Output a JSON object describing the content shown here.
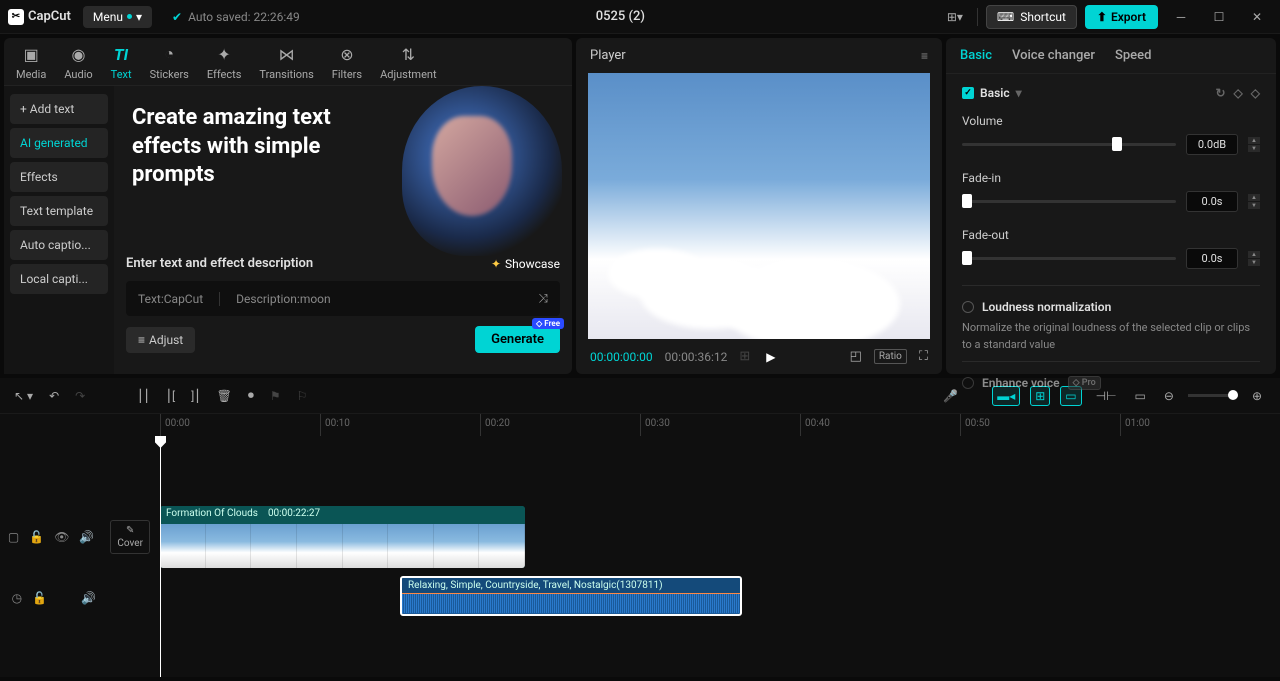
{
  "titlebar": {
    "app_name": "CapCut",
    "menu_label": "Menu",
    "autosave_text": "Auto saved: 22:26:49",
    "project_title": "0525 (2)",
    "shortcut_label": "Shortcut",
    "export_label": "Export"
  },
  "top_tabs": [
    {
      "label": "Media",
      "icon": "▶"
    },
    {
      "label": "Audio",
      "icon": "◉"
    },
    {
      "label": "Text",
      "icon": "TI",
      "active": true
    },
    {
      "label": "Stickers",
      "icon": "◔"
    },
    {
      "label": "Effects",
      "icon": "✦"
    },
    {
      "label": "Transitions",
      "icon": "⋈"
    },
    {
      "label": "Filters",
      "icon": "⊗"
    },
    {
      "label": "Adjustment",
      "icon": "⇄"
    }
  ],
  "sidebar": [
    {
      "label": "Add text",
      "add": true
    },
    {
      "label": "AI generated",
      "active": true
    },
    {
      "label": "Effects"
    },
    {
      "label": "Text template"
    },
    {
      "label": "Auto captio..."
    },
    {
      "label": "Local capti..."
    }
  ],
  "hero": {
    "headline": "Create amazing text effects with simple prompts"
  },
  "prompt": {
    "title": "Enter text and effect description",
    "showcase": "Showcase",
    "text_label": "Text:CapCut",
    "desc_label": "Description:moon",
    "adjust_label": "Adjust",
    "generate_label": "Generate",
    "free_badge": "◇ Free"
  },
  "player": {
    "title": "Player",
    "current_tc": "00:00:00:00",
    "duration_tc": "00:00:36:12",
    "ratio_label": "Ratio"
  },
  "right_panel": {
    "tabs": [
      {
        "label": "Basic",
        "active": true
      },
      {
        "label": "Voice changer"
      },
      {
        "label": "Speed"
      }
    ],
    "section_title": "Basic",
    "volume_label": "Volume",
    "volume_value": "0.0dB",
    "fadein_label": "Fade-in",
    "fadein_value": "0.0s",
    "fadeout_label": "Fade-out",
    "fadeout_value": "0.0s",
    "loudness_label": "Loudness normalization",
    "loudness_desc": "Normalize the original loudness of the selected clip or clips to a standard value",
    "enhance_label": "Enhance voice",
    "beta_label": "◇ Pro"
  },
  "timeline": {
    "ruler": [
      "00:00",
      "00:10",
      "00:20",
      "00:30",
      "00:40",
      "00:50",
      "01:00"
    ],
    "cover_label": "Cover",
    "video_clip": {
      "name": "Formation Of Clouds",
      "duration": "00:00:22:27"
    },
    "audio_clip": {
      "name": "Relaxing, Simple, Countryside, Travel, Nostalgic(1307811)"
    }
  }
}
